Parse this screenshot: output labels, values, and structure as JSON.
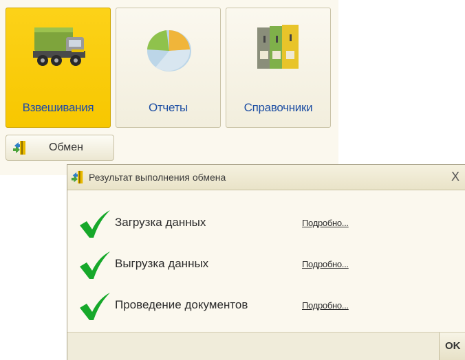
{
  "tiles": [
    {
      "label": "Взвешивания",
      "icon": "truck-icon",
      "active": true
    },
    {
      "label": "Отчеты",
      "icon": "pie-chart-icon",
      "active": false
    },
    {
      "label": "Справочники",
      "icon": "binders-icon",
      "active": false
    }
  ],
  "exchange_button": {
    "label": "Обмен",
    "icon": "exchange-icon"
  },
  "dialog": {
    "title": "Результат выполнения обмена",
    "close_glyph": "X",
    "rows": [
      {
        "text": "Загрузка данных",
        "link": "Подробно...",
        "status_icon": "check-icon"
      },
      {
        "text": "Выгрузка данных",
        "link": "Подробно...",
        "status_icon": "check-icon"
      },
      {
        "text": "Проведение документов",
        "link": "Подробно...",
        "status_icon": "check-icon"
      }
    ],
    "ok_label": "OK"
  },
  "colors": {
    "active_tile": "#f9cc00",
    "label_blue": "#1d4ea3",
    "check_green": "#16a82a",
    "panel_bg": "#fbf8ee"
  }
}
